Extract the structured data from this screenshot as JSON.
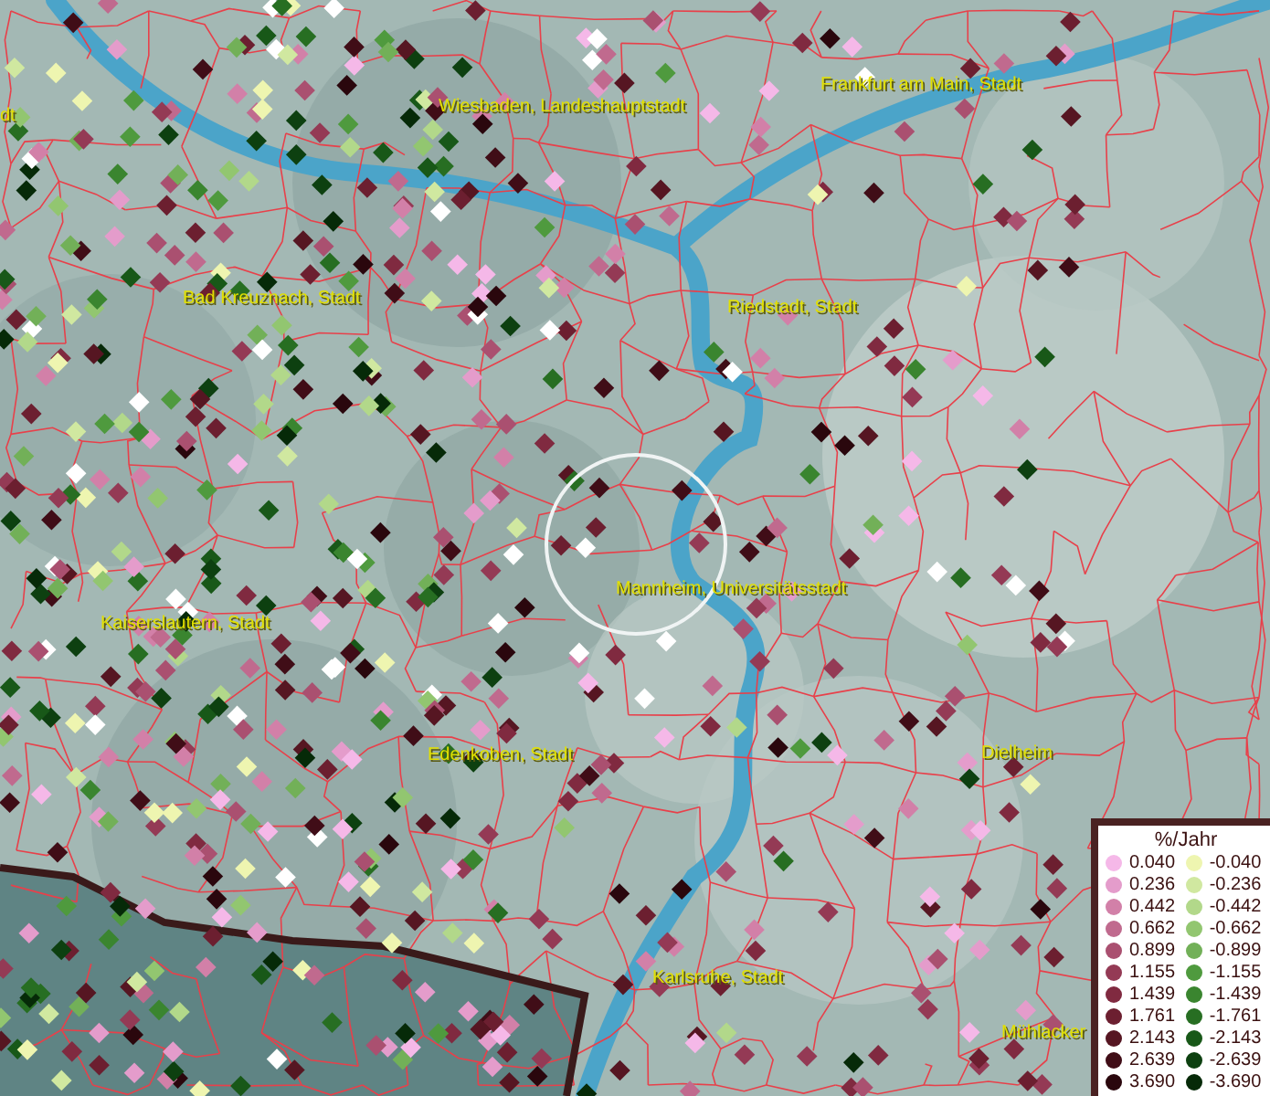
{
  "map": {
    "places": [
      {
        "label": "dt"
      },
      {
        "label": "Wiesbaden, Landeshauptstadt"
      },
      {
        "label": "Frankfurt am Main, Stadt"
      },
      {
        "label": "Bad Kreuznach, Stadt"
      },
      {
        "label": "Riedstadt, Stadt"
      },
      {
        "label": "Kaiserslautern, Stadt"
      },
      {
        "label": "Mannheim, Universitätsstadt"
      },
      {
        "label": "Edenkoben, Stadt"
      },
      {
        "label": "Dielheim"
      },
      {
        "label": "Karlsruhe, Stadt"
      },
      {
        "label": "Mühlacker"
      }
    ]
  },
  "legend": {
    "title": "%/Jahr",
    "increase": [
      {
        "label": "0.040",
        "color": "#f5b8e8"
      },
      {
        "label": "0.236",
        "color": "#e49ccb"
      },
      {
        "label": "0.442",
        "color": "#d280a8"
      },
      {
        "label": "0.662",
        "color": "#c06a8e"
      },
      {
        "label": "0.899",
        "color": "#aa5070"
      },
      {
        "label": "1.155",
        "color": "#943a55"
      },
      {
        "label": "1.439",
        "color": "#802a40"
      },
      {
        "label": "1.761",
        "color": "#6c1f30"
      },
      {
        "label": "2.143",
        "color": "#561622"
      },
      {
        "label": "2.639",
        "color": "#400d17"
      },
      {
        "label": "3.690",
        "color": "#2a070d"
      }
    ],
    "decrease": [
      {
        "label": "-0.040",
        "color": "#eef5b0"
      },
      {
        "label": "-0.236",
        "color": "#d0e8a0"
      },
      {
        "label": "-0.442",
        "color": "#b2d88a"
      },
      {
        "label": "-0.662",
        "color": "#92c670"
      },
      {
        "label": "-0.899",
        "color": "#72b058"
      },
      {
        "label": "-1.155",
        "color": "#4f9a3e"
      },
      {
        "label": "-1.439",
        "color": "#3a852f"
      },
      {
        "label": "-1.761",
        "color": "#276e22"
      },
      {
        "label": "-2.143",
        "color": "#185818"
      },
      {
        "label": "-2.639",
        "color": "#0d4010"
      },
      {
        "label": "-3.690",
        "color": "#062a08"
      }
    ]
  }
}
